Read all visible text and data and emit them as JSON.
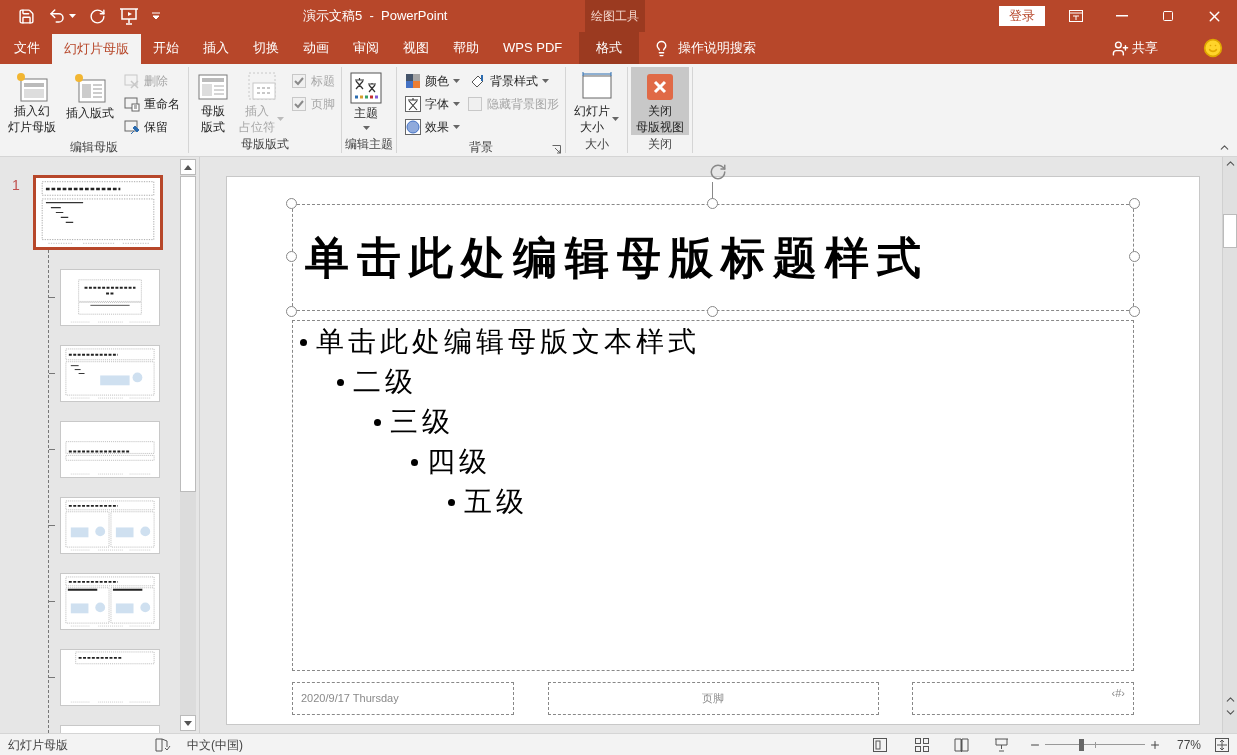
{
  "window": {
    "title": "演示文稿5  -  PowerPoint",
    "context_group": "绘图工具",
    "sign_in": "登录"
  },
  "tabs": [
    {
      "label": "文件",
      "selected": false,
      "kind": "normal"
    },
    {
      "label": "幻灯片母版",
      "selected": true,
      "kind": "normal"
    },
    {
      "label": "开始",
      "selected": false,
      "kind": "normal"
    },
    {
      "label": "插入",
      "selected": false,
      "kind": "normal"
    },
    {
      "label": "切换",
      "selected": false,
      "kind": "normal"
    },
    {
      "label": "动画",
      "selected": false,
      "kind": "normal"
    },
    {
      "label": "审阅",
      "selected": false,
      "kind": "normal"
    },
    {
      "label": "视图",
      "selected": false,
      "kind": "normal"
    },
    {
      "label": "帮助",
      "selected": false,
      "kind": "normal"
    },
    {
      "label": "WPS PDF",
      "selected": false,
      "kind": "normal"
    },
    {
      "label": "格式",
      "selected": false,
      "kind": "context"
    }
  ],
  "tell_me": "操作说明搜索",
  "share": "共享",
  "ribbon": {
    "groups": [
      {
        "label": "编辑母版",
        "items": [
          {
            "kind": "large",
            "lines": [
              "插入幻",
              "灯片母版"
            ],
            "disabled": false,
            "dropdown": false,
            "highlighted": false
          },
          {
            "kind": "large",
            "lines": [
              "插入版式"
            ],
            "disabled": false,
            "dropdown": false,
            "highlighted": false
          },
          {
            "kind": "stack",
            "items": [
              {
                "kind": "small",
                "label": "删除",
                "disabled": true,
                "dropdown": false
              },
              {
                "kind": "small",
                "label": "重命名",
                "disabled": false,
                "dropdown": false
              },
              {
                "kind": "small",
                "label": "保留",
                "disabled": false,
                "dropdown": false
              }
            ]
          }
        ]
      },
      {
        "label": "母版版式",
        "items": [
          {
            "kind": "large",
            "lines": [
              "母版",
              "版式"
            ],
            "disabled": false,
            "dropdown": false,
            "highlighted": false
          },
          {
            "kind": "large",
            "lines": [
              "插入",
              "占位符"
            ],
            "disabled": true,
            "dropdown": true,
            "highlighted": false
          },
          {
            "kind": "stack",
            "items": [
              {
                "kind": "check",
                "label": "标题",
                "disabled": true,
                "checked": true
              },
              {
                "kind": "check",
                "label": "页脚",
                "disabled": true,
                "checked": true
              }
            ]
          }
        ]
      },
      {
        "label": "编辑主题",
        "items": [
          {
            "kind": "large",
            "lines": [
              "主题"
            ],
            "disabled": false,
            "dropdown": true,
            "highlighted": false
          }
        ]
      },
      {
        "label": "背景",
        "launcher": true,
        "items": [
          {
            "kind": "stack",
            "items": [
              {
                "kind": "small",
                "label": "颜色",
                "disabled": false,
                "dropdown": true
              },
              {
                "kind": "small",
                "label": "字体",
                "disabled": false,
                "dropdown": true
              },
              {
                "kind": "small",
                "label": "效果",
                "disabled": false,
                "dropdown": true
              }
            ]
          },
          {
            "kind": "stack",
            "items": [
              {
                "kind": "small",
                "label": "背景样式",
                "disabled": false,
                "dropdown": true
              },
              {
                "kind": "check",
                "label": "隐藏背景图形",
                "disabled": true,
                "checked": false
              }
            ]
          }
        ]
      },
      {
        "label": "大小",
        "items": [
          {
            "kind": "large",
            "lines": [
              "幻灯片",
              "大小"
            ],
            "disabled": false,
            "dropdown": true,
            "highlighted": false
          }
        ]
      },
      {
        "label": "关闭",
        "items": [
          {
            "kind": "large",
            "lines": [
              "关闭",
              "母版视图"
            ],
            "disabled": false,
            "dropdown": false,
            "highlighted": true
          }
        ]
      }
    ]
  },
  "thumbnails": [
    {
      "number": "1",
      "selected": true,
      "kind": "master"
    },
    {
      "selected": false,
      "kind": "title"
    },
    {
      "selected": false,
      "kind": "content"
    },
    {
      "selected": false,
      "kind": "section"
    },
    {
      "selected": false,
      "kind": "two"
    },
    {
      "selected": false,
      "kind": "compare"
    },
    {
      "selected": false,
      "kind": "title-only"
    },
    {
      "selected": false,
      "kind": "blank"
    }
  ],
  "slide": {
    "title": "单击此处编辑母版标题样式",
    "body": [
      {
        "text": "单击此处编辑母版文本样式",
        "children": [
          {
            "text": "二级",
            "children": [
              {
                "text": "三级",
                "children": [
                  {
                    "text": "四级",
                    "children": [
                      {
                        "text": "五级"
                      }
                    ]
                  }
                ]
              }
            ]
          }
        ]
      }
    ],
    "footer": {
      "date": "2020/9/17 Thursday",
      "footer": "页脚",
      "number": "‹#›"
    }
  },
  "status_bar": {
    "mode": "幻灯片母版",
    "language": "中文(中国)",
    "zoom": {
      "level": 0.36,
      "reading": "77%"
    }
  }
}
